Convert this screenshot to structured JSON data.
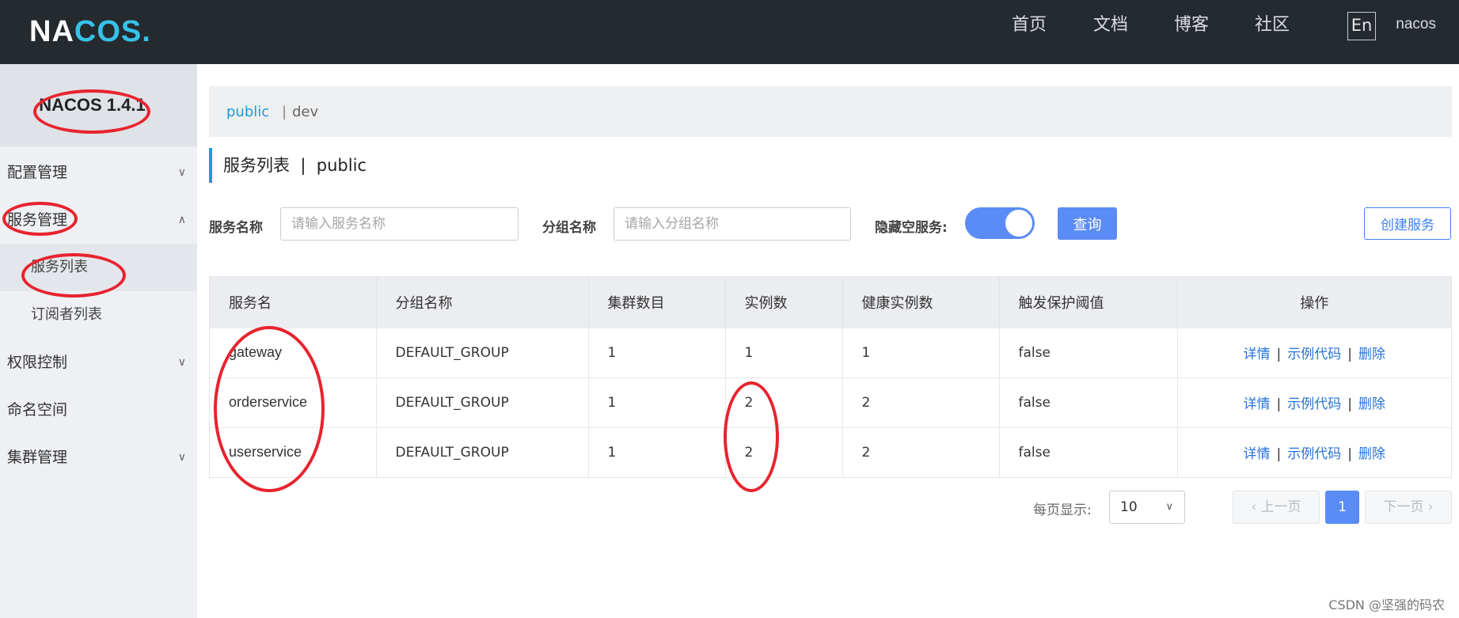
{
  "header": {
    "logo_left": "NA",
    "logo_mid": "COS",
    "logo_dot": ".",
    "nav": [
      "首页",
      "文档",
      "博客",
      "社区"
    ],
    "lang": "En",
    "user": "nacos"
  },
  "sidebar": {
    "version": "NACOS 1.4.1",
    "items": [
      {
        "label": "配置管理",
        "chev": "∨"
      },
      {
        "label": "服务管理",
        "chev": "∧"
      },
      {
        "label": "服务列表"
      },
      {
        "label": "订阅者列表"
      },
      {
        "label": "权限控制",
        "chev": "∨"
      },
      {
        "label": "命名空间"
      },
      {
        "label": "集群管理",
        "chev": "∨"
      }
    ]
  },
  "namespace": {
    "active": "public",
    "separator": "|",
    "other": "dev"
  },
  "page": {
    "title": "服务列表  |  public"
  },
  "filters": {
    "service_label": "服务名称",
    "service_placeholder": "请输入服务名称",
    "group_label": "分组名称",
    "group_placeholder": "请输入分组名称",
    "hide_empty_label": "隐藏空服务:",
    "hide_empty_on": true,
    "query_button": "查询",
    "create_button": "创建服务"
  },
  "table": {
    "columns": [
      "服务名",
      "分组名称",
      "集群数目",
      "实例数",
      "健康实例数",
      "触发保护阈值",
      "操作"
    ],
    "rows": [
      [
        "gateway",
        "DEFAULT_GROUP",
        "1",
        "1",
        "1",
        "false"
      ],
      [
        "orderservice",
        "DEFAULT_GROUP",
        "1",
        "2",
        "2",
        "false"
      ],
      [
        "userservice",
        "DEFAULT_GROUP",
        "1",
        "2",
        "2",
        "false"
      ]
    ],
    "actions": [
      "详情",
      "示例代码",
      "删除"
    ],
    "action_sep": "|"
  },
  "pagination": {
    "per_page_label": "每页显示:",
    "per_page": "10",
    "prev": "上一页",
    "next": "下一页",
    "current": "1"
  },
  "watermark": "CSDN @坚强的码农",
  "colors": {
    "accent": "#5b8cf5",
    "link": "#2573d9",
    "annotation": "#e8232f",
    "topbar": "#252a2f"
  }
}
